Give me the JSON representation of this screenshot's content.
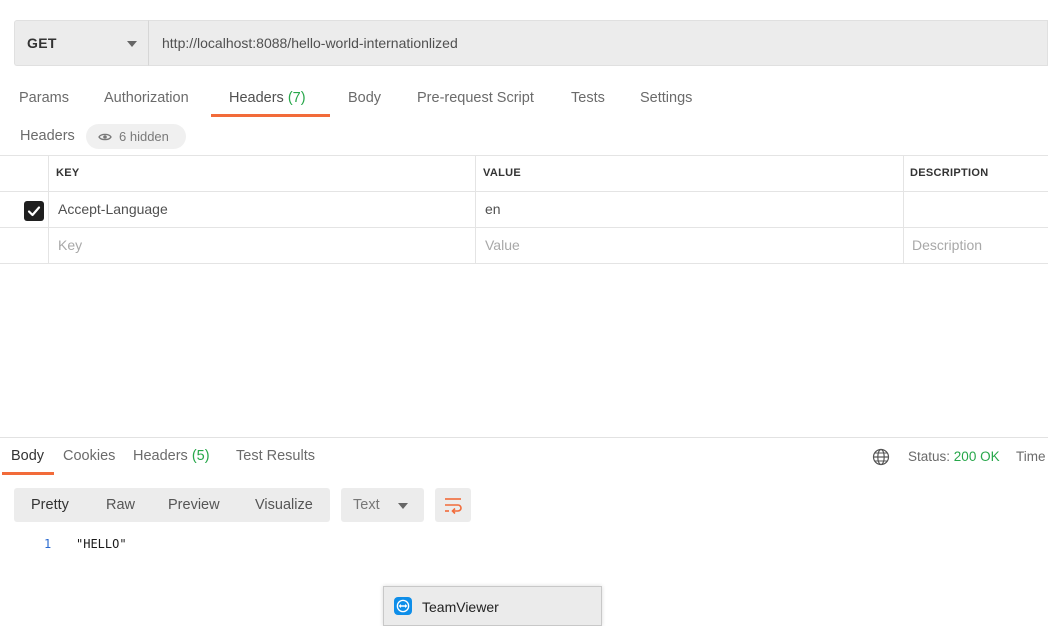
{
  "request": {
    "method": "GET",
    "url": "http://localhost:8088/hello-world-internationlized"
  },
  "request_tabs": [
    {
      "label": "Params"
    },
    {
      "label": "Authorization"
    },
    {
      "label": "Headers",
      "count": "(7)",
      "active": true
    },
    {
      "label": "Body"
    },
    {
      "label": "Pre-request Script"
    },
    {
      "label": "Tests"
    },
    {
      "label": "Settings"
    }
  ],
  "headers_section": {
    "title": "Headers",
    "hidden_label": "6 hidden",
    "columns": [
      "KEY",
      "VALUE",
      "DESCRIPTION"
    ],
    "rows": [
      {
        "checked": true,
        "key": "Accept-Language",
        "value": "en",
        "description": ""
      }
    ],
    "placeholders": {
      "key": "Key",
      "value": "Value",
      "description": "Description"
    }
  },
  "response_tabs": [
    {
      "label": "Body",
      "active": true
    },
    {
      "label": "Cookies"
    },
    {
      "label": "Headers",
      "count": "(5)"
    },
    {
      "label": "Test Results"
    }
  ],
  "status": {
    "label": "Status:",
    "value": "200 OK",
    "time_label": "Time"
  },
  "format_toolbar": {
    "modes": [
      "Pretty",
      "Raw",
      "Preview",
      "Visualize"
    ],
    "selected_type": "Text"
  },
  "response_body": {
    "lines": [
      {
        "number": "1",
        "text": "\"HELLO\""
      }
    ]
  },
  "popup": {
    "title": "TeamViewer"
  },
  "colors": {
    "accent": "#f26b3a",
    "success": "#27a74a",
    "line_number": "#2a6ad0",
    "teamviewer_blue": "#0e8ee9"
  },
  "icons": [
    "chevron-down-icon",
    "eye-icon",
    "checkbox-check-icon",
    "globe-icon",
    "wrap-lines-icon",
    "teamviewer-icon"
  ]
}
